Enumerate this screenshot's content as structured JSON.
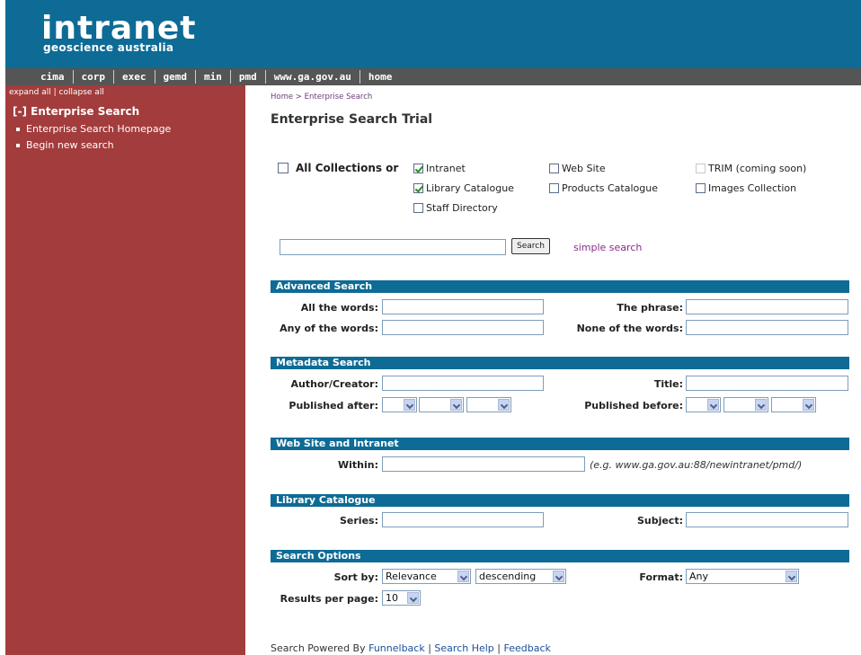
{
  "header": {
    "logo_main": "intranet",
    "logo_sub": "geoscience australia"
  },
  "nav": [
    "cima",
    "corp",
    "exec",
    "gemd",
    "min",
    "pmd",
    "www.ga.gov.au",
    "home"
  ],
  "sidebar": {
    "expand": "expand all",
    "sep": "|",
    "collapse": "collapse all",
    "heading": "[-] Enterprise Search",
    "items": [
      {
        "label": "Enterprise Search Homepage"
      },
      {
        "label": "Begin new search"
      }
    ]
  },
  "breadcrumb": {
    "home": "Home",
    "sep": " > ",
    "current": "Enterprise Search"
  },
  "page_title": "Enterprise Search Trial",
  "collections": {
    "all_label": "All Collections or",
    "items": [
      {
        "label": "Intranet",
        "checked": true
      },
      {
        "label": "Web Site",
        "checked": false
      },
      {
        "label": "TRIM (coming soon)",
        "checked": false
      },
      {
        "label": "Library Catalogue",
        "checked": true
      },
      {
        "label": "Products Catalogue",
        "checked": false
      },
      {
        "label": "Images Collection",
        "checked": false
      },
      {
        "label": "Staff Directory",
        "checked": false
      }
    ]
  },
  "search": {
    "button": "Search",
    "simple_link": "simple search"
  },
  "advanced": {
    "title": "Advanced Search",
    "all_words": "All the words:",
    "phrase": "The phrase:",
    "any_words": "Any of the words:",
    "none_words": "None of the words:"
  },
  "metadata": {
    "title": "Metadata Search",
    "author": "Author/Creator:",
    "title_label": "Title:",
    "published_after": "Published after:",
    "published_before": "Published before:"
  },
  "website": {
    "title": "Web Site and Intranet",
    "within": "Within:",
    "hint": "(e.g. www.ga.gov.au:88/newintranet/pmd/)"
  },
  "library": {
    "title": "Library Catalogue",
    "series": "Series:",
    "subject": "Subject:"
  },
  "options": {
    "title": "Search Options",
    "sort_label": "Sort by:",
    "sort_value": "Relevance",
    "order_value": "descending",
    "format_label": "Format:",
    "format_value": "Any",
    "results_label": "Results per page:",
    "results_value": "10"
  },
  "footer": {
    "prefix": "Search Powered By ",
    "funnelback": "Funnelback",
    "sep1": " | ",
    "help": "Search Help",
    "sep2": " | ",
    "feedback": "Feedback"
  }
}
